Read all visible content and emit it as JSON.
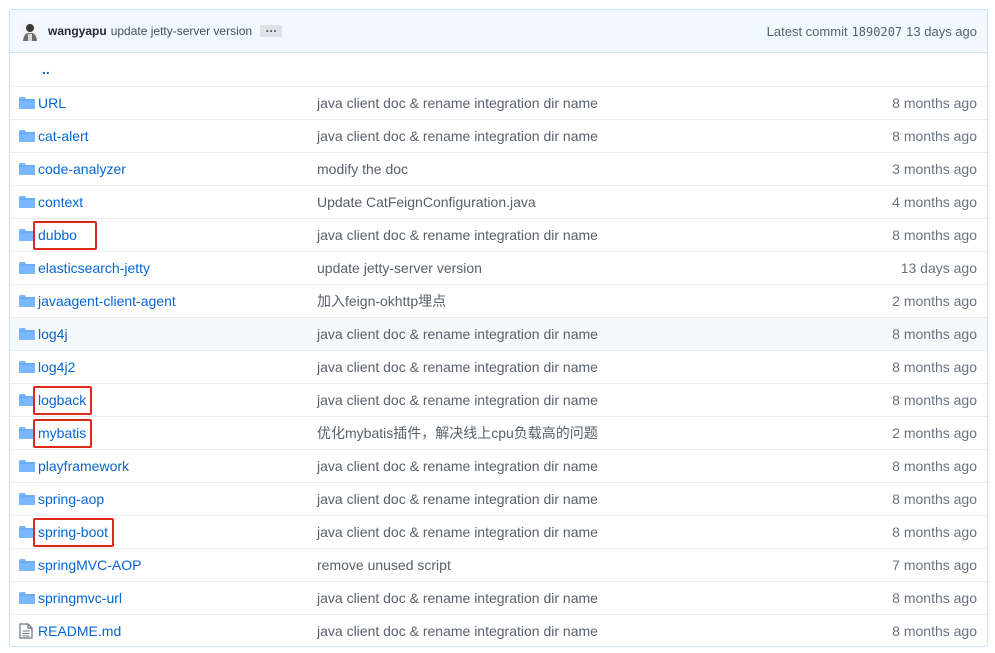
{
  "commit": {
    "author": "wangyapu",
    "message": "update jetty-server version",
    "ellipsis": "…",
    "latest_label": "Latest commit",
    "sha": "1890207",
    "age": "13 days ago"
  },
  "up_dir": "..",
  "colors": {
    "link": "#0366d6",
    "folder": "#79b8ff",
    "highlight_box": "#e1261c"
  },
  "files": [
    {
      "name": "URL",
      "type": "folder",
      "message": "java client doc & rename integration dir name",
      "age": "8 months ago"
    },
    {
      "name": "cat-alert",
      "type": "folder",
      "message": "java client doc & rename integration dir name",
      "age": "8 months ago"
    },
    {
      "name": "code-analyzer",
      "type": "folder",
      "message": "modify the doc",
      "age": "3 months ago"
    },
    {
      "name": "context",
      "type": "folder",
      "message": "Update CatFeignConfiguration.java",
      "age": "4 months ago"
    },
    {
      "name": "dubbo",
      "type": "folder",
      "message": "java client doc & rename integration dir name",
      "age": "8 months ago"
    },
    {
      "name": "elasticsearch-jetty",
      "type": "folder",
      "message": "update jetty-server version",
      "age": "13 days ago"
    },
    {
      "name": "javaagent-client-agent",
      "type": "folder",
      "message": "加入feign-okhttp埋点",
      "age": "2 months ago"
    },
    {
      "name": "log4j",
      "type": "folder",
      "message": "java client doc & rename integration dir name",
      "age": "8 months ago"
    },
    {
      "name": "log4j2",
      "type": "folder",
      "message": "java client doc & rename integration dir name",
      "age": "8 months ago"
    },
    {
      "name": "logback",
      "type": "folder",
      "message": "java client doc & rename integration dir name",
      "age": "8 months ago"
    },
    {
      "name": "mybatis",
      "type": "folder",
      "message": "优化mybatis插件，解决线上cpu负载高的问题",
      "age": "2 months ago"
    },
    {
      "name": "playframework",
      "type": "folder",
      "message": "java client doc & rename integration dir name",
      "age": "8 months ago"
    },
    {
      "name": "spring-aop",
      "type": "folder",
      "message": "java client doc & rename integration dir name",
      "age": "8 months ago"
    },
    {
      "name": "spring-boot",
      "type": "folder",
      "message": "java client doc & rename integration dir name",
      "age": "8 months ago"
    },
    {
      "name": "springMVC-AOP",
      "type": "folder",
      "message": "remove unused script",
      "age": "7 months ago"
    },
    {
      "name": "springmvc-url",
      "type": "folder",
      "message": "java client doc & rename integration dir name",
      "age": "8 months ago"
    },
    {
      "name": "README.md",
      "type": "file",
      "message": "java client doc & rename integration dir name",
      "age": "8 months ago"
    }
  ]
}
